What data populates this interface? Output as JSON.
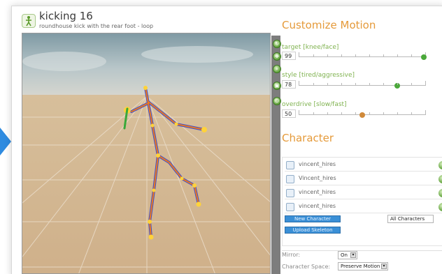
{
  "animation": {
    "title": "kicking 16",
    "subtitle": "roundhouse kick with the rear foot - loop"
  },
  "viewport_tools": [
    {
      "name": "rotate-icon",
      "glyph": "↻"
    },
    {
      "name": "pan-icon",
      "glyph": "✥"
    },
    {
      "name": "zoom-icon",
      "glyph": "⌕"
    },
    {
      "name": "camera-icon",
      "glyph": "▣"
    },
    {
      "name": "power-icon",
      "glyph": "⏻"
    }
  ],
  "customize": {
    "title": "Customize Motion",
    "sliders": [
      {
        "label": "target [knee/face]",
        "value": "99",
        "fraction": 0.99,
        "knob_color": "#4aa83a"
      },
      {
        "label": "style [tired/aggressive]",
        "value": "78",
        "fraction": 0.78,
        "knob_color": "#4aa83a"
      },
      {
        "label": "overdrive [slow/fast]",
        "value": "50",
        "fraction": 0.5,
        "knob_color": "#d08a3a"
      }
    ]
  },
  "character": {
    "title": "Character",
    "items": [
      "vincent_hires",
      "Vincent_hires",
      "vincent_hires",
      "vincent_hires"
    ],
    "new_button": "New Character",
    "upload_button": "Upload Skeleton",
    "filter": "All Characters"
  },
  "options": {
    "mirror_label": "Mirror:",
    "mirror_value": "On",
    "space_label": "Character Space:",
    "space_value": "Preserve Motion"
  },
  "colors": {
    "accent_orange": "#e59a3a",
    "label_green": "#7fb24f",
    "button_blue": "#3a8fd6",
    "bone_orange": "#f07a1a",
    "bone_blue": "#3d4fd0"
  }
}
